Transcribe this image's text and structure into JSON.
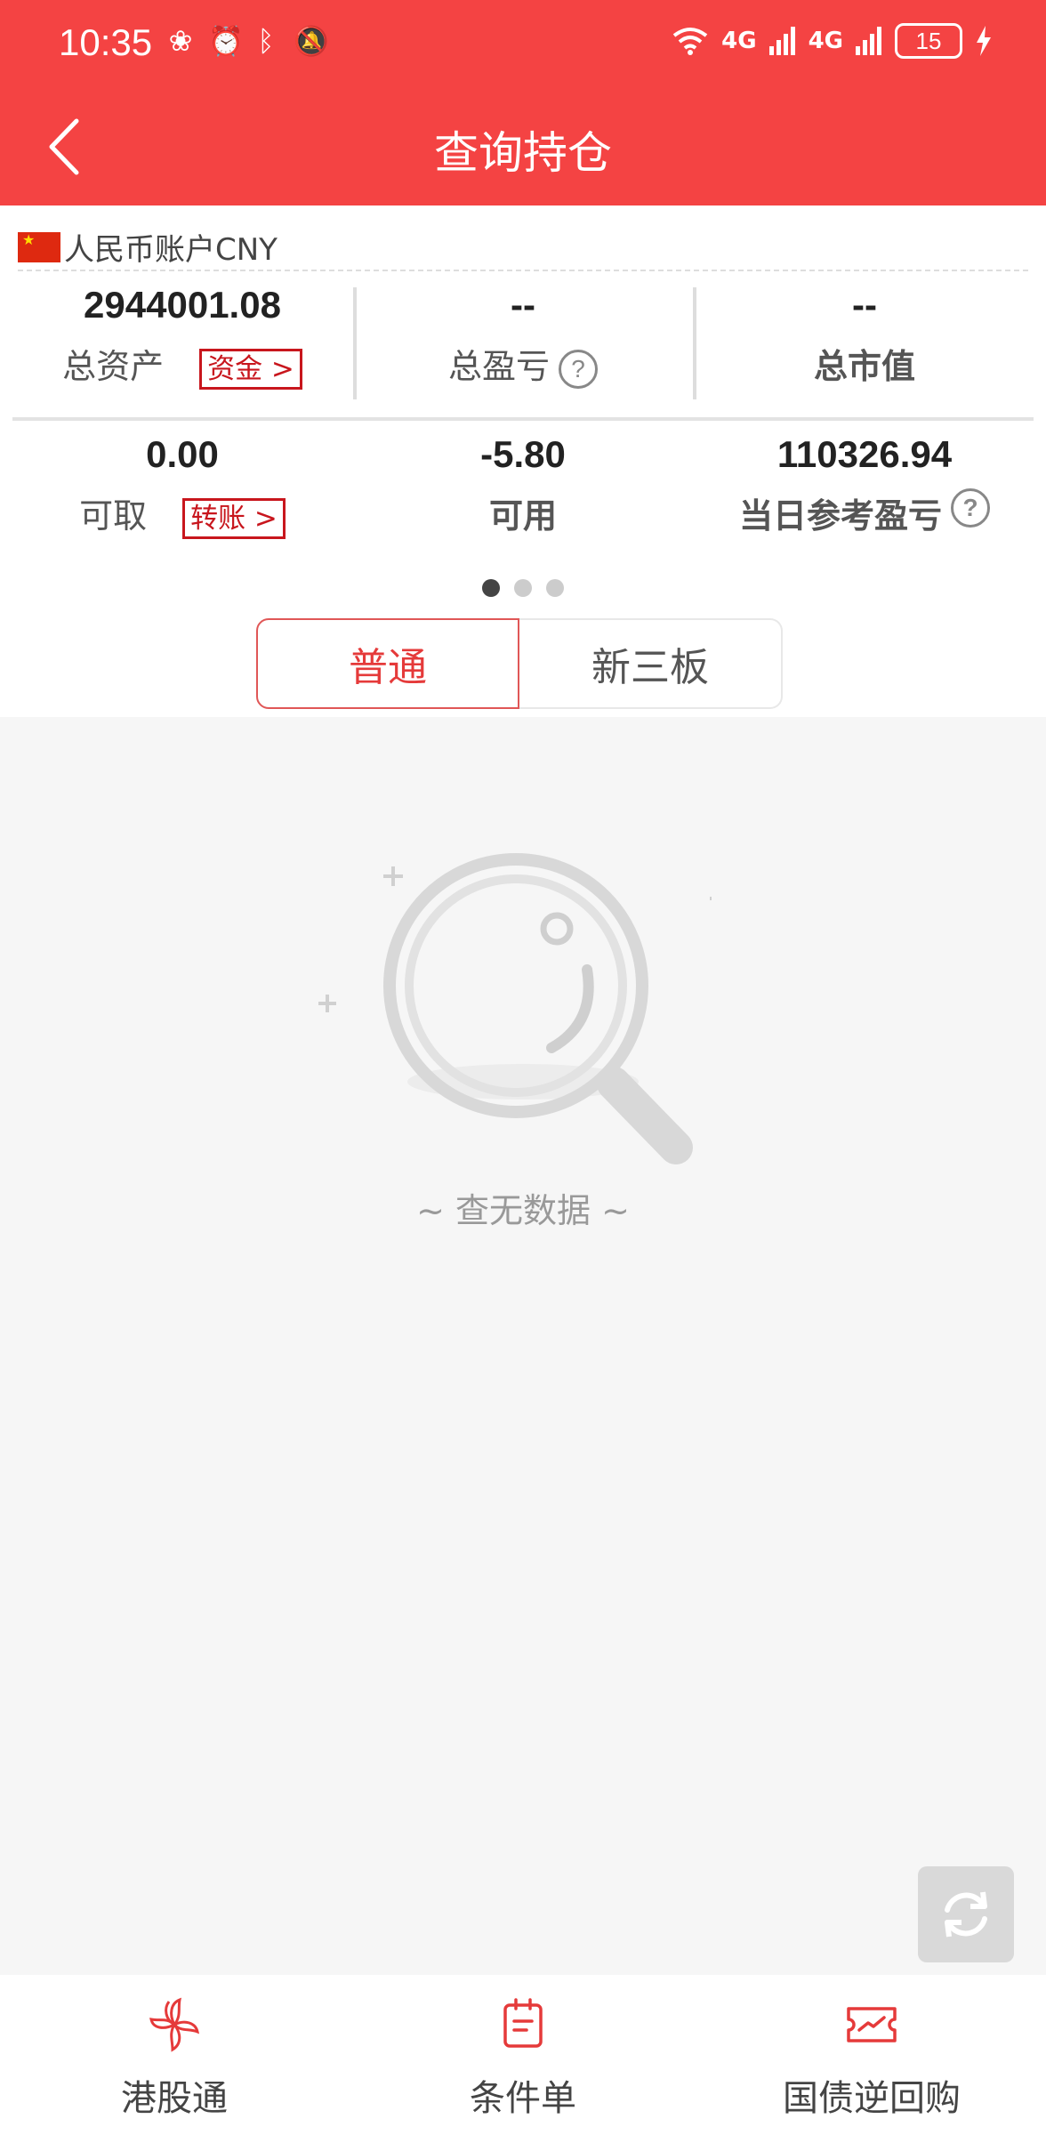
{
  "status_bar": {
    "time": "10:35",
    "signal_1": "4G",
    "signal_2": "4G",
    "battery": "15"
  },
  "header": {
    "title": "查询持仓"
  },
  "account": {
    "currency_label": "人民币账户CNY",
    "row1": [
      {
        "value": "2944001.08",
        "label": "总资产",
        "link": "资金 >"
      },
      {
        "value": "--",
        "label": "总盈亏"
      },
      {
        "value": "--",
        "label": "总市值"
      }
    ],
    "row2": [
      {
        "value": "0.00",
        "label": "可取",
        "link": "转账 >"
      },
      {
        "value": "-5.80",
        "label": "可用"
      },
      {
        "value": "110326.94",
        "label": "当日参考盈亏"
      }
    ],
    "help_glyph": "?"
  },
  "pager": {
    "count": 3,
    "active_index": 0
  },
  "segments": [
    {
      "label": "普通",
      "active": true
    },
    {
      "label": "新三板",
      "active": false
    }
  ],
  "empty_state": {
    "text": "~ 查无数据 ~"
  },
  "bottom_nav": [
    {
      "label": "港股通",
      "icon": "bauhinia-icon"
    },
    {
      "label": "条件单",
      "icon": "document-list-icon"
    },
    {
      "label": "国债逆回购",
      "icon": "ticket-chart-icon"
    }
  ],
  "colors": {
    "brand_red": "#f44343",
    "link_red": "#c8161d",
    "active_tab_red": "#e53a3a"
  }
}
